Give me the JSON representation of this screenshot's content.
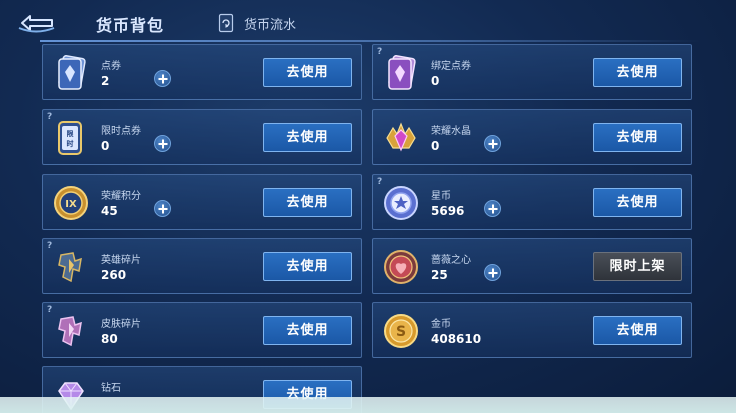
{
  "header": {
    "title": "货币背包",
    "flow_tab_label": "货币流水"
  },
  "colors": {
    "accent_button": "#2a6fc2",
    "disabled_button": "#3a3f47",
    "background": "#122a52"
  },
  "currencies_left": [
    {
      "name": "点券",
      "amount": "2",
      "has_help": false,
      "has_plus": true,
      "button": "去使用",
      "icon": "coupon-card-icon"
    },
    {
      "name": "限时点券",
      "amount": "0",
      "has_help": true,
      "has_plus": true,
      "button": "去使用",
      "icon": "limited-coupon-icon"
    },
    {
      "name": "荣耀积分",
      "amount": "45",
      "has_help": false,
      "has_plus": true,
      "button": "去使用",
      "icon": "glory-points-icon"
    },
    {
      "name": "英雄碎片",
      "amount": "260",
      "has_help": true,
      "has_plus": false,
      "button": "去使用",
      "icon": "hero-fragment-icon"
    },
    {
      "name": "皮肤碎片",
      "amount": "80",
      "has_help": true,
      "has_plus": false,
      "button": "去使用",
      "icon": "skin-fragment-icon"
    },
    {
      "name": "钻石",
      "amount": "",
      "has_help": false,
      "has_plus": false,
      "button": "去使用",
      "icon": "diamond-icon"
    }
  ],
  "currencies_right": [
    {
      "name": "绑定点券",
      "amount": "0",
      "has_help": true,
      "has_plus": false,
      "button": "去使用",
      "icon": "bound-coupon-icon"
    },
    {
      "name": "荣耀水晶",
      "amount": "0",
      "has_help": false,
      "has_plus": true,
      "button": "去使用",
      "icon": "glory-crystal-icon"
    },
    {
      "name": "星币",
      "amount": "5696",
      "has_help": true,
      "has_plus": true,
      "button": "去使用",
      "icon": "star-coin-icon"
    },
    {
      "name": "蔷薇之心",
      "amount": "25",
      "has_help": false,
      "has_plus": true,
      "button": "限时上架",
      "icon": "rose-heart-icon"
    },
    {
      "name": "金币",
      "amount": "408610",
      "has_help": false,
      "has_plus": false,
      "button": "去使用",
      "icon": "gold-coin-icon"
    }
  ]
}
